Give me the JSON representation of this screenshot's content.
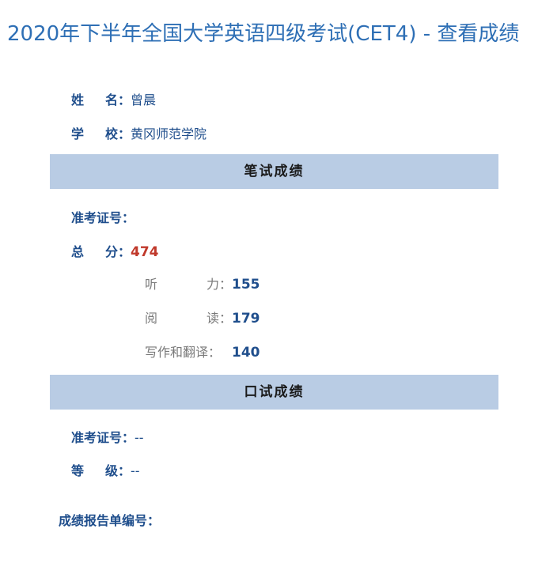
{
  "page": {
    "title": "2020年下半年全国大学英语四级考试(CET4) - 查看成绩"
  },
  "candidate": {
    "name_label_a": "姓",
    "name_label_b": "名：",
    "name": "曾晨",
    "school_label_a": "学",
    "school_label_b": "校：",
    "school": "黄冈师范学院"
  },
  "written": {
    "section_title": "笔试成绩",
    "ticket_label": "准考证号：",
    "ticket_value": "",
    "total_label_a": "总",
    "total_label_b": "分：",
    "total": "474",
    "listening_label_a": "听",
    "listening_label_b": "力：",
    "listening": "155",
    "reading_label_a": "阅",
    "reading_label_b": "读：",
    "reading": "179",
    "writing_label": "写作和翻译：",
    "writing": "140"
  },
  "oral": {
    "section_title": "口试成绩",
    "ticket_label": "准考证号：",
    "ticket_value": "--",
    "grade_label_a": "等",
    "grade_label_b": "级：",
    "grade": "--"
  },
  "report": {
    "label": "成绩报告单编号：",
    "value": ""
  },
  "colors": {
    "title": "#2e6fb5",
    "label": "#1f4e8c",
    "section_bg": "#b9cce4",
    "total": "#c0392b",
    "sub_label": "#7a7a7a"
  }
}
